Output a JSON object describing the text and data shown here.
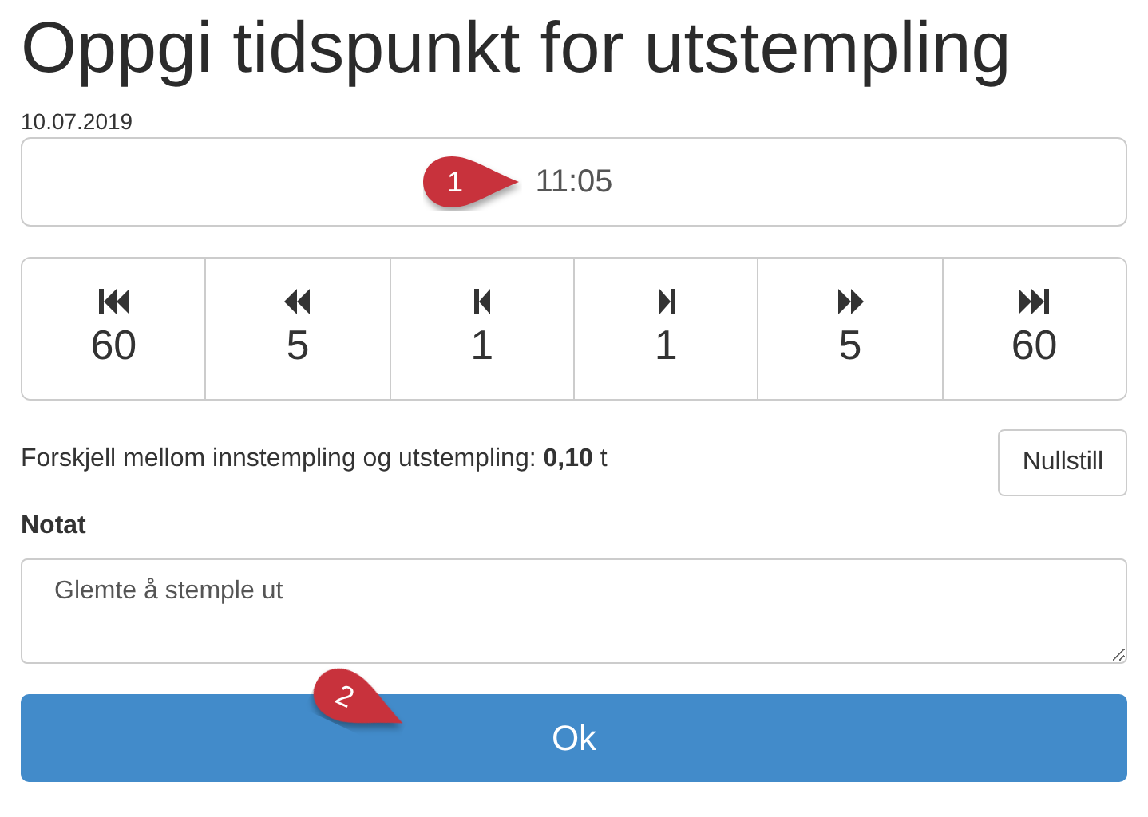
{
  "title": "Oppgi tidspunkt for utstempling",
  "date": "10.07.2019",
  "time_field": {
    "value": "11:05"
  },
  "step_buttons": [
    {
      "kind": "fast-backward",
      "label": "60"
    },
    {
      "kind": "backward",
      "label": "5"
    },
    {
      "kind": "step-backward",
      "label": "1"
    },
    {
      "kind": "step-forward",
      "label": "1"
    },
    {
      "kind": "forward",
      "label": "5"
    },
    {
      "kind": "fast-forward",
      "label": "60"
    }
  ],
  "difference": {
    "text": "Forskjell mellom innstempling og utstempling: **0,10** t"
  },
  "reset_button": "Nullstill",
  "note": {
    "label": "Notat",
    "value": "Glemte å stemple ut"
  },
  "ok_button": "Ok",
  "callouts": [
    {
      "number": "1"
    },
    {
      "number": "2"
    }
  ]
}
